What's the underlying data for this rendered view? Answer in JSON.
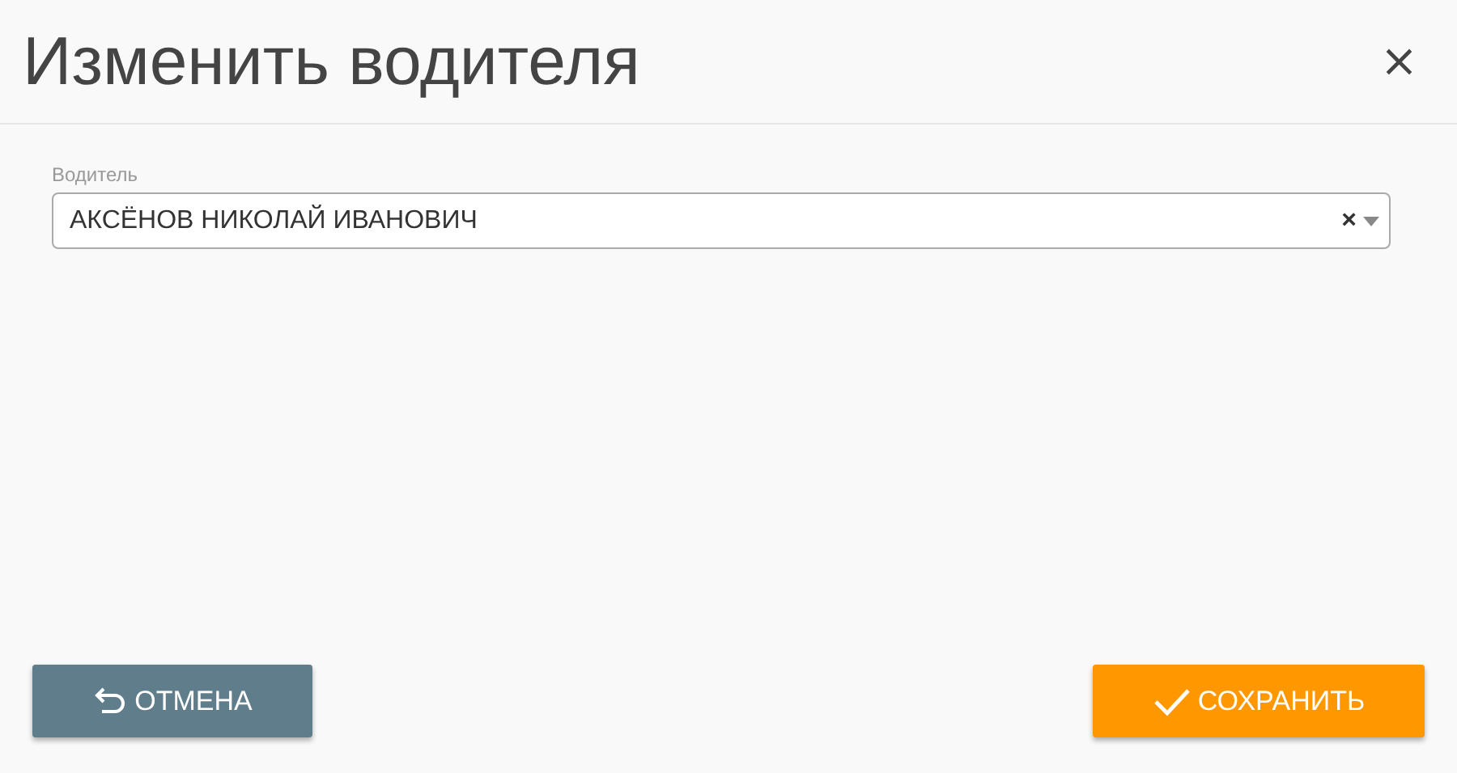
{
  "dialog": {
    "title": "Изменить водителя",
    "close_label": "×"
  },
  "driver_field": {
    "label": "Водитель",
    "value": "АКСЁНОВ НИКОЛАЙ ИВАНОВИЧ",
    "clear_label": "×"
  },
  "buttons": [
    {
      "kind": "cancel",
      "label": "ОТМЕНА"
    },
    {
      "kind": "save",
      "label": "СОХРАНИТЬ"
    }
  ]
}
